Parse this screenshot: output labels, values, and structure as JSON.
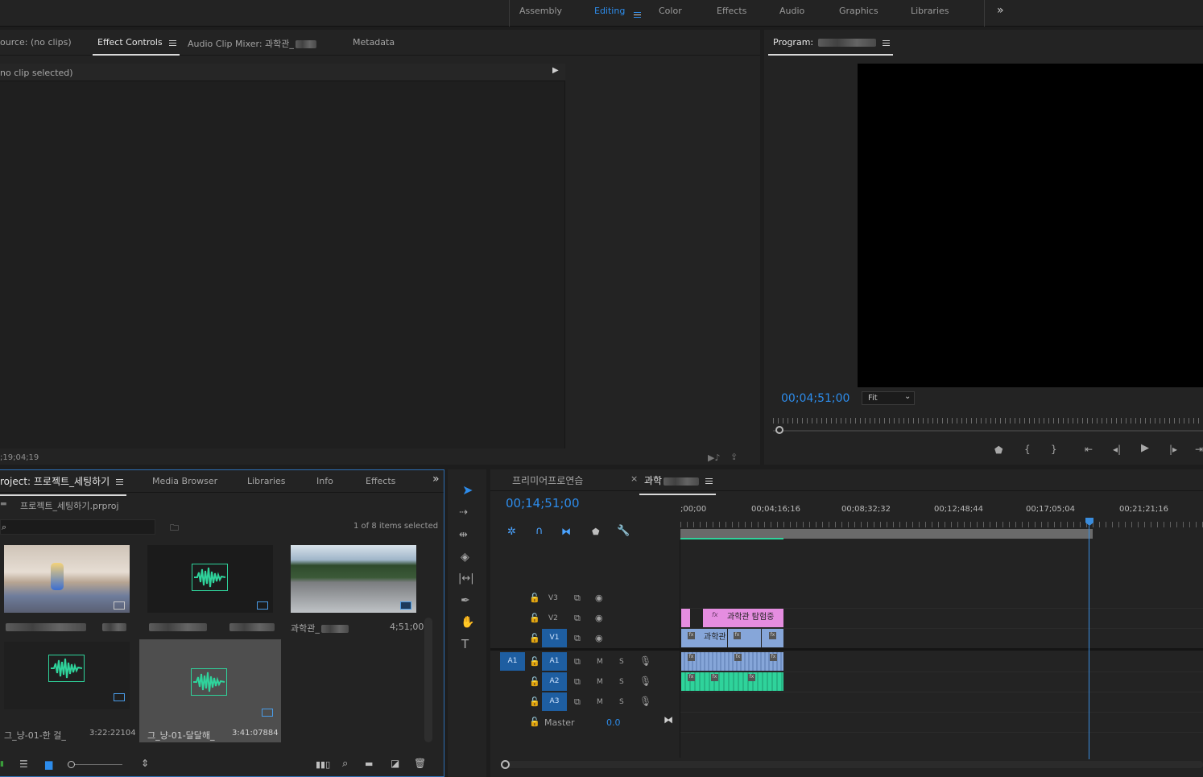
{
  "workspaces": {
    "tabs": [
      "Assembly",
      "Editing",
      "Color",
      "Effects",
      "Audio",
      "Graphics",
      "Libraries"
    ],
    "active": "Editing",
    "overflow_glyph": "»"
  },
  "source_panel": {
    "tabs": {
      "source": "ource: (no clips)",
      "effect_controls": "Effect Controls",
      "audio_mixer": "Audio Clip Mixer: 과학관_",
      "metadata": "Metadata"
    },
    "no_clip_text": "no clip selected)",
    "timecode": ";19;04;19"
  },
  "program_monitor": {
    "title": "Program: ",
    "timecode": "00;04;51;00",
    "zoom": "Fit"
  },
  "project_panel": {
    "tabs": {
      "project": "roject: 프로젝트_세팅하기",
      "media_browser": "Media Browser",
      "libraries": "Libraries",
      "info": "Info",
      "effects": "Effects"
    },
    "project_file": "프로젝트_세팅하기.prproj",
    "search_placeholder": "",
    "selection_status": "1 of 8 items selected",
    "items": [
      {
        "name": "",
        "duration": "",
        "type": "video"
      },
      {
        "name": "",
        "duration": "",
        "type": "audio"
      },
      {
        "name": "과학관_",
        "duration": "4;51;00",
        "type": "video"
      },
      {
        "name": "그_냥-01-한 걸_",
        "duration": "3:22:22104",
        "type": "audio"
      },
      {
        "name": "그_냥-01-달달해_",
        "duration": "3:41:07884",
        "type": "audio"
      }
    ]
  },
  "timeline": {
    "tabs": {
      "sequence1": "프리미어프로연습",
      "sequence2": "과학"
    },
    "close_glyph": "×",
    "timecode": "00;14;51;00",
    "ruler": [
      ";00;00",
      "00;04;16;16",
      "00;08;32;32",
      "00;12;48;44",
      "00;17;05;04",
      "00;21;21;16"
    ],
    "video_tracks": [
      "V3",
      "V2",
      "V1"
    ],
    "audio_tracks": [
      "A1",
      "A2",
      "A3"
    ],
    "source_patch": "A1",
    "master_label": "Master",
    "master_value": "0.0",
    "mute_label": "M",
    "solo_label": "S",
    "clips": {
      "v2_title": "과학관 탐험중",
      "v1_title": "과학관",
      "fx_label": "fx"
    }
  },
  "tools": [
    "selection",
    "track-select",
    "ripple-edit",
    "razor",
    "slip",
    "pen",
    "hand",
    "type"
  ],
  "colors": {
    "accent": "#2d8ceb",
    "clip_video": "#86a6d9",
    "clip_title": "#e58de0",
    "clip_audio": "#2fd39b",
    "playhead": "#3a8dde"
  }
}
